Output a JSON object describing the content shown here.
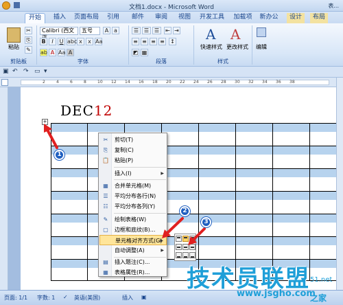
{
  "window": {
    "title": "文档1.docx - Microsoft Word",
    "right_label": "表..."
  },
  "tabs": [
    {
      "label": "开始",
      "active": true
    },
    {
      "label": "插入"
    },
    {
      "label": "页面布局"
    },
    {
      "label": "引用"
    },
    {
      "label": "邮件"
    },
    {
      "label": "审阅"
    },
    {
      "label": "视图"
    },
    {
      "label": "开发工具"
    },
    {
      "label": "加载项"
    },
    {
      "label": "新办公"
    },
    {
      "label": "设计"
    },
    {
      "label": "布局"
    }
  ],
  "ribbon": {
    "paste_label": "粘贴",
    "clipboard_group": "剪贴板",
    "font_name": "Calibri (西文正",
    "font_size": "五号",
    "font_group": "字体",
    "paragraph_group": "段落",
    "quick_styles": "快速样式",
    "change_styles": "更改样式",
    "styles_group": "样式",
    "editing": "编辑"
  },
  "ruler_ticks": [
    "2",
    "4",
    "6",
    "8",
    "10",
    "12",
    "14",
    "16",
    "18",
    "20",
    "22",
    "24",
    "26",
    "28",
    "30",
    "32",
    "34",
    "36",
    "38"
  ],
  "document": {
    "heading_black": "DEC",
    "heading_red": "12",
    "table_handle": "+"
  },
  "context_menu": {
    "items": [
      {
        "icon": "✂",
        "label": "剪切(T)"
      },
      {
        "icon": "⎘",
        "label": "复制(C)"
      },
      {
        "icon": "📋",
        "label": "粘贴(P)"
      },
      {
        "icon": "",
        "label": "插入(I)",
        "submenu": true
      },
      {
        "icon": "▦",
        "label": "合并单元格(M)"
      },
      {
        "icon": "☰",
        "label": "平均分布各行(N)"
      },
      {
        "icon": "☷",
        "label": "平均分布各列(Y)"
      },
      {
        "icon": "✎",
        "label": "绘制表格(W)"
      },
      {
        "icon": "▢",
        "label": "边框和底纹(B)..."
      },
      {
        "icon": "",
        "label": "单元格对齐方式(G)",
        "submenu": true,
        "highlighted": true
      },
      {
        "icon": "",
        "label": "自动调整(A)",
        "submenu": true
      },
      {
        "icon": "▤",
        "label": "插入题注(C)..."
      },
      {
        "icon": "▦",
        "label": "表格属性(R)..."
      }
    ]
  },
  "callouts": [
    "1",
    "2",
    "3"
  ],
  "statusbar": {
    "page": "页面: 1/1",
    "words": "字数: 1",
    "lang": "英语(美国)",
    "insert": "插入"
  },
  "watermark": {
    "big": "技术员联盟",
    "url": "www.jsgho.com",
    "site": "之家",
    "num": "51.net"
  }
}
